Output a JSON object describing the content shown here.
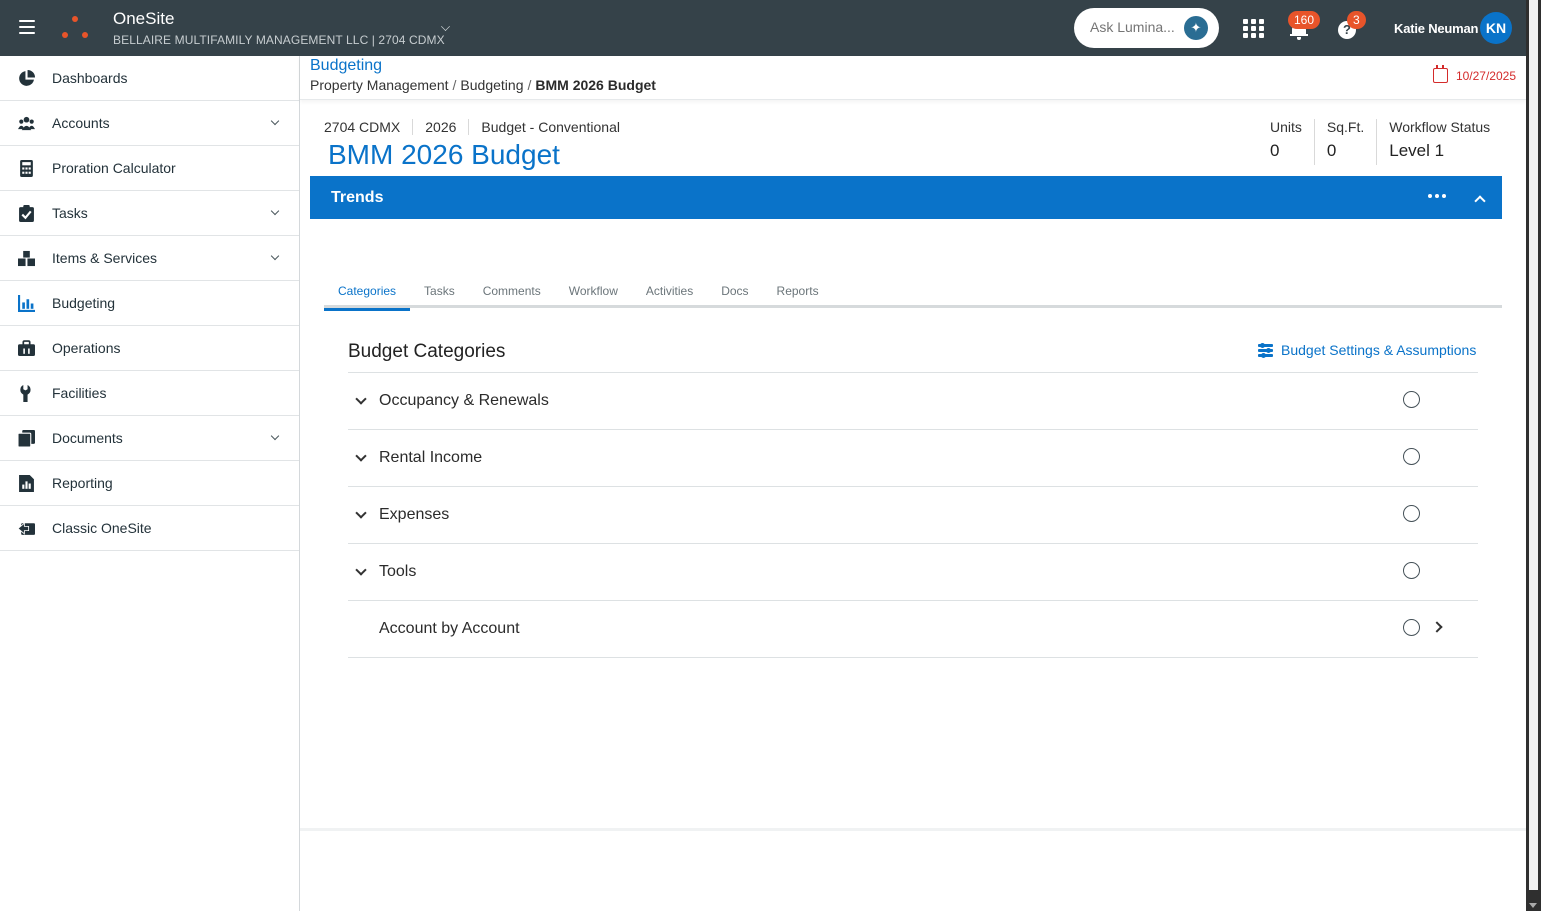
{
  "topbar": {
    "app_name": "OneSite",
    "company": "BELLAIRE MULTIFAMILY MANAGEMENT LLC | 2704 CDMX",
    "ask_placeholder": "Ask Lumina...",
    "notifications_count": "160",
    "help_count": "3",
    "user_name": "Katie Neuman",
    "user_initials": "KN"
  },
  "sidebar": {
    "items": [
      {
        "label": "Dashboards",
        "icon": "pie-chart-icon",
        "has_submenu": false
      },
      {
        "label": "Accounts",
        "icon": "users-icon",
        "has_submenu": true
      },
      {
        "label": "Proration Calculator",
        "icon": "calculator-icon",
        "has_submenu": false
      },
      {
        "label": "Tasks",
        "icon": "clipboard-check-icon",
        "has_submenu": true
      },
      {
        "label": "Items & Services",
        "icon": "boxes-icon",
        "has_submenu": true
      },
      {
        "label": "Budgeting",
        "icon": "bar-chart-icon",
        "has_submenu": false
      },
      {
        "label": "Operations",
        "icon": "briefcase-icon",
        "has_submenu": false
      },
      {
        "label": "Facilities",
        "icon": "wrench-icon",
        "has_submenu": false
      },
      {
        "label": "Documents",
        "icon": "documents-icon",
        "has_submenu": true
      },
      {
        "label": "Reporting",
        "icon": "report-icon",
        "has_submenu": false
      },
      {
        "label": "Classic OneSite",
        "icon": "classic-icon",
        "has_submenu": false
      }
    ]
  },
  "header": {
    "title": "Budgeting",
    "breadcrumb": [
      "Property Management",
      "Budgeting",
      "BMM 2026 Budget"
    ],
    "date": "10/27/2025"
  },
  "budget": {
    "property": "2704 CDMX",
    "year": "2026",
    "type": "Budget - Conventional",
    "title": "BMM 2026 Budget",
    "stats": [
      {
        "label": "Units",
        "value": "0"
      },
      {
        "label": "Sq.Ft.",
        "value": "0"
      },
      {
        "label": "Workflow Status",
        "value": "Level 1"
      }
    ]
  },
  "trends": {
    "label": "Trends"
  },
  "tabs": [
    "Categories",
    "Tasks",
    "Comments",
    "Workflow",
    "Activities",
    "Docs",
    "Reports"
  ],
  "categories": {
    "heading": "Budget Categories",
    "settings_link": "Budget Settings & Assumptions",
    "rows": [
      {
        "label": "Occupancy & Renewals",
        "expandable": true
      },
      {
        "label": "Rental Income",
        "expandable": true
      },
      {
        "label": "Expenses",
        "expandable": true
      },
      {
        "label": "Tools",
        "expandable": true
      },
      {
        "label": "Account by Account",
        "expandable": false
      }
    ]
  },
  "colors": {
    "topbar": "#354249",
    "accent": "#0a73c9",
    "badge": "#e8542a",
    "date": "#d42b2b"
  }
}
